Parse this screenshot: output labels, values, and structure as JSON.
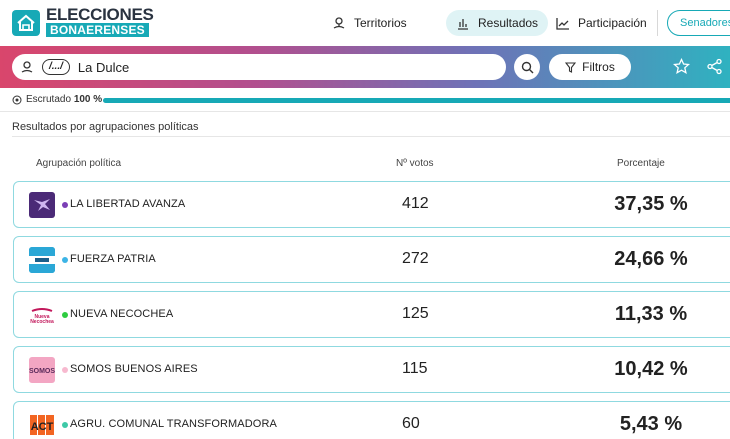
{
  "header": {
    "logo_line1": "ELECCIONES",
    "logo_line2": "BONAERENSES",
    "nav": [
      {
        "label": "Territorios",
        "icon": "map-pin-icon"
      },
      {
        "label": "Resultados",
        "icon": "bar-chart-icon",
        "active": true
      },
      {
        "label": "Participación",
        "icon": "line-chart-icon"
      }
    ],
    "senadores_label": "Senadores P"
  },
  "search": {
    "abbr": "/.../",
    "location": "La Dulce",
    "filters_label": "Filtros"
  },
  "progress": {
    "label": "Escrutado",
    "value_text": "100 %",
    "value": 1.0
  },
  "section_title": "Resultados por agrupaciones políticas",
  "table": {
    "headers": {
      "party": "Agrupación política",
      "votes": "Nº votos",
      "percent": "Porcentaje"
    },
    "rows": [
      {
        "name": "LA LIBERTAD AVANZA",
        "votes": "412",
        "percent": "37,35 %",
        "color": "#7b3fb5",
        "logo": "lla-logo"
      },
      {
        "name": "FUERZA PATRIA",
        "votes": "272",
        "percent": "24,66 %",
        "color": "#3cb4e6",
        "logo": "fuerza-patria-logo"
      },
      {
        "name": "NUEVA NECOCHEA",
        "votes": "125",
        "percent": "11,33 %",
        "color": "#2ecc40",
        "logo": "nueva-necochea-logo"
      },
      {
        "name": "SOMOS BUENOS AIRES",
        "votes": "115",
        "percent": "10,42 %",
        "color": "#f7b9cf",
        "logo": "somos-logo"
      },
      {
        "name": "AGRU. COMUNAL TRANSFORMADORA",
        "votes": "60",
        "percent": "5,43 %",
        "color": "#3ec9a7",
        "logo": "acu-logo"
      }
    ]
  },
  "logo_texts": {
    "nueva_necochea": "Nueva Necochea",
    "somos": "SOMOS",
    "acu": "ACT"
  },
  "colors": {
    "accent": "#17a9b6",
    "gradient": [
      "#d9466c",
      "#b24f8e",
      "#6e72b7",
      "#2fb2c0"
    ]
  }
}
